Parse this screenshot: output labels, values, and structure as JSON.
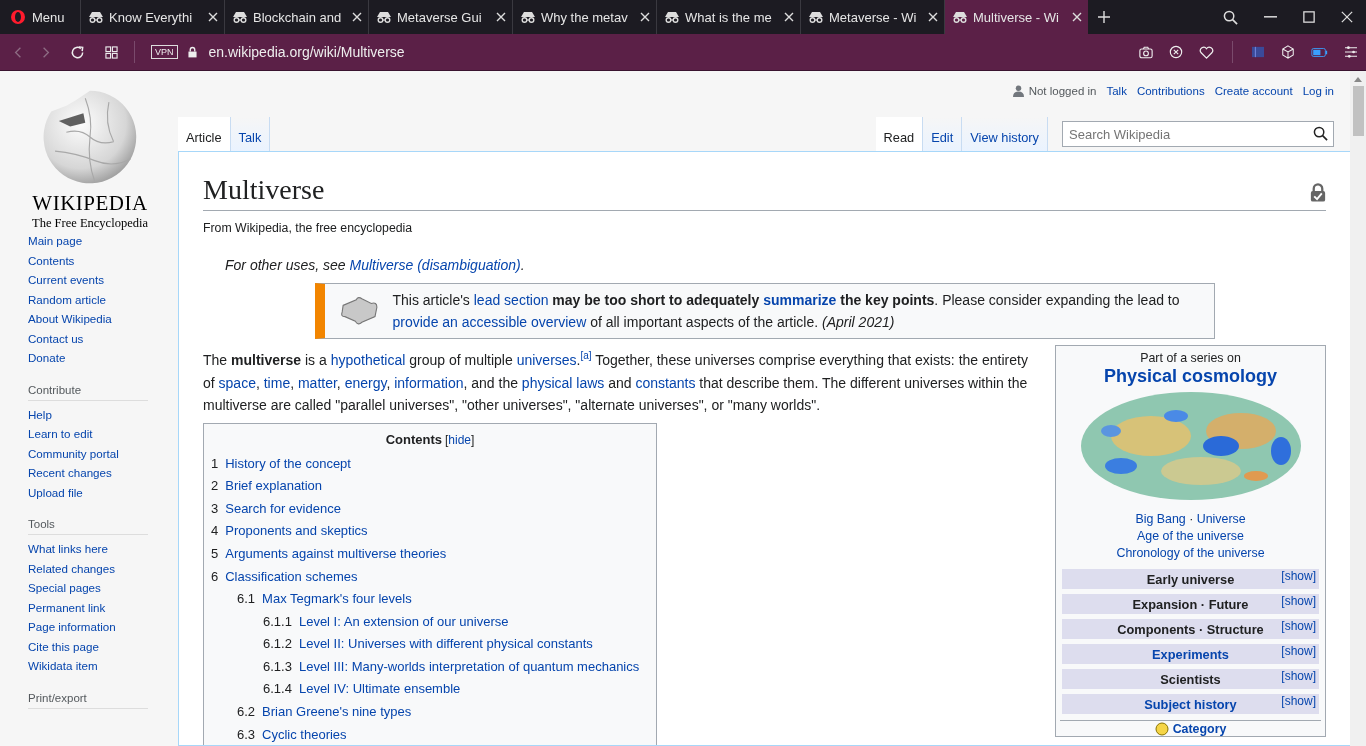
{
  "browser": {
    "menu_label": "Menu",
    "tabs": [
      {
        "title": "Know Everythi",
        "selected": false
      },
      {
        "title": "Blockchain and",
        "selected": false
      },
      {
        "title": "Metaverse Gui",
        "selected": false
      },
      {
        "title": "Why the metav",
        "selected": false
      },
      {
        "title": "What is the me",
        "selected": false
      },
      {
        "title": "Metaverse - Wi",
        "selected": false
      },
      {
        "title": "Multiverse - Wi",
        "selected": true
      }
    ],
    "vpn_label": "VPN",
    "url": "en.wikipedia.org/wiki/Multiverse"
  },
  "wiki": {
    "wordmark": "WIKIPEDIA",
    "tagline": "The Free Encyclopedia",
    "sidebar": [
      {
        "items": [
          "Main page",
          "Contents",
          "Current events",
          "Random article",
          "About Wikipedia",
          "Contact us",
          "Donate"
        ]
      },
      {
        "heading": "Contribute",
        "items": [
          "Help",
          "Learn to edit",
          "Community portal",
          "Recent changes",
          "Upload file"
        ]
      },
      {
        "heading": "Tools",
        "items": [
          "What links here",
          "Related changes",
          "Special pages",
          "Permanent link",
          "Page information",
          "Cite this page",
          "Wikidata item"
        ]
      },
      {
        "heading": "Print/export"
      }
    ],
    "personal": {
      "status": "Not logged in",
      "links": [
        "Talk",
        "Contributions",
        "Create account",
        "Log in"
      ]
    },
    "namespace_tabs": [
      {
        "label": "Article",
        "selected": true
      },
      {
        "label": "Talk",
        "selected": false
      }
    ],
    "view_tabs": [
      {
        "label": "Read",
        "selected": true
      },
      {
        "label": "Edit",
        "selected": false
      },
      {
        "label": "View history",
        "selected": false
      }
    ],
    "search": {
      "placeholder": "Search Wikipedia"
    },
    "article": {
      "title": "Multiverse",
      "tagline": "From Wikipedia, the free encyclopedia",
      "hatnote": [
        {
          "kind": "text",
          "text": "For other uses, see "
        },
        {
          "kind": "link",
          "text": "Multiverse (disambiguation)"
        },
        {
          "kind": "text",
          "text": "."
        }
      ],
      "notice": [
        {
          "kind": "text",
          "text": "This article's "
        },
        {
          "kind": "link",
          "text": "lead section"
        },
        {
          "kind": "bold",
          "text": " may be too short to adequately "
        },
        {
          "kind": "boldlink",
          "text": "summarize"
        },
        {
          "kind": "bold",
          "text": " the key points"
        },
        {
          "kind": "text",
          "text": ". Please consider expanding the lead to "
        },
        {
          "kind": "link",
          "text": "provide an accessible overview"
        },
        {
          "kind": "text",
          "text": " of all important aspects of the article. "
        },
        {
          "kind": "italic",
          "text": "(April 2021)"
        }
      ],
      "lead": [
        {
          "kind": "text",
          "text": "The "
        },
        {
          "kind": "bold",
          "text": "multiverse"
        },
        {
          "kind": "text",
          "text": " is a "
        },
        {
          "kind": "link",
          "text": "hypothetical"
        },
        {
          "kind": "text",
          "text": " group of multiple "
        },
        {
          "kind": "link",
          "text": "universes"
        },
        {
          "kind": "text",
          "text": "."
        },
        {
          "kind": "sup",
          "text": "[a]"
        },
        {
          "kind": "text",
          "text": " Together, these universes comprise everything that exists: the entirety of "
        },
        {
          "kind": "link",
          "text": "space"
        },
        {
          "kind": "text",
          "text": ", "
        },
        {
          "kind": "link",
          "text": "time"
        },
        {
          "kind": "text",
          "text": ", "
        },
        {
          "kind": "link",
          "text": "matter"
        },
        {
          "kind": "text",
          "text": ", "
        },
        {
          "kind": "link",
          "text": "energy"
        },
        {
          "kind": "text",
          "text": ", "
        },
        {
          "kind": "link",
          "text": "information"
        },
        {
          "kind": "text",
          "text": ", and the "
        },
        {
          "kind": "link",
          "text": "physical laws"
        },
        {
          "kind": "text",
          "text": " and "
        },
        {
          "kind": "link",
          "text": "constants"
        },
        {
          "kind": "text",
          "text": " that describe them. The different universes within the multiverse are called \"parallel universes\", \"other universes\", \"alternate universes\", or \"many worlds\"."
        }
      ],
      "toc": {
        "title": "Contents",
        "toggle": {
          "before": "[",
          "label": "hide",
          "after": "]"
        },
        "items": [
          {
            "num": "1",
            "title": "History of the concept"
          },
          {
            "num": "2",
            "title": "Brief explanation"
          },
          {
            "num": "3",
            "title": "Search for evidence"
          },
          {
            "num": "4",
            "title": "Proponents and skeptics"
          },
          {
            "num": "5",
            "title": "Arguments against multiverse theories"
          },
          {
            "num": "6",
            "title": "Classification schemes",
            "children": [
              {
                "num": "6.1",
                "title": "Max Tegmark's four levels",
                "children": [
                  {
                    "num": "6.1.1",
                    "title": "Level I: An extension of our universe"
                  },
                  {
                    "num": "6.1.2",
                    "title": "Level II: Universes with different physical constants"
                  },
                  {
                    "num": "6.1.3",
                    "title": "Level III: Many-worlds interpretation of quantum mechanics"
                  },
                  {
                    "num": "6.1.4",
                    "title": "Level IV: Ultimate ensemble"
                  }
                ]
              },
              {
                "num": "6.2",
                "title": "Brian Greene's nine types"
              },
              {
                "num": "6.3",
                "title": "Cyclic theories"
              }
            ]
          }
        ]
      }
    },
    "infobox": {
      "above": "Part of a series on",
      "title": "Physical cosmology",
      "link_lines": [
        [
          {
            "kind": "link",
            "text": "Big Bang"
          },
          {
            "kind": "text",
            "text": " · "
          },
          {
            "kind": "link",
            "text": "Universe"
          }
        ],
        [
          {
            "kind": "link",
            "text": "Age of the universe"
          }
        ],
        [
          {
            "kind": "link",
            "text": "Chronology of the universe"
          }
        ]
      ],
      "sections": [
        {
          "title": "Early universe",
          "kind": "plain",
          "toggle": "[show]"
        },
        {
          "title": "Expansion · Future",
          "kind": "plain",
          "toggle": "[show]"
        },
        {
          "title": "Components · Structure",
          "kind": "plain",
          "toggle": "[show]"
        },
        {
          "title": "Experiments",
          "kind": "link",
          "toggle": "[show]"
        },
        {
          "title": "Scientists",
          "kind": "plain",
          "toggle": "[show]"
        },
        {
          "title": "Subject history",
          "kind": "link",
          "toggle": "[show]"
        }
      ],
      "footer": "Category"
    }
  }
}
